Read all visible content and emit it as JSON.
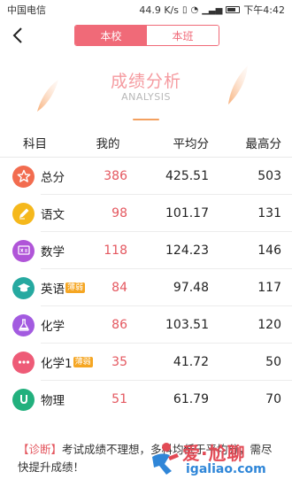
{
  "status_bar": {
    "carrier": "中国电信",
    "speed": "44.9 K/s",
    "time": "下午4:42"
  },
  "nav": {
    "tabs": [
      {
        "label": "本校",
        "active": true
      },
      {
        "label": "本班",
        "active": false
      }
    ]
  },
  "header": {
    "title": "成绩分析",
    "subtitle": "ANALYSIS"
  },
  "table": {
    "columns": [
      "科目",
      "我的",
      "平均分",
      "最高分"
    ],
    "rows": [
      {
        "subject": "总分",
        "icon": "star-icon",
        "icon_color": "#f26c4f",
        "badge": "",
        "mine": "386",
        "avg": "425.51",
        "max": "503"
      },
      {
        "subject": "语文",
        "icon": "pen-icon",
        "icon_color": "#f5b81c",
        "badge": "",
        "mine": "98",
        "avg": "101.17",
        "max": "131"
      },
      {
        "subject": "数学",
        "icon": "math-board-icon",
        "icon_color": "#b055d8",
        "badge": "",
        "mine": "118",
        "avg": "124.23",
        "max": "146"
      },
      {
        "subject": "英语",
        "icon": "graduation-cap-icon",
        "icon_color": "#26a9a0",
        "badge": "薄弱",
        "mine": "84",
        "avg": "97.48",
        "max": "117"
      },
      {
        "subject": "化学",
        "icon": "flask-icon",
        "icon_color": "#a35be0",
        "badge": "",
        "mine": "86",
        "avg": "103.51",
        "max": "120"
      },
      {
        "subject": "化学1",
        "icon": "dots-icon",
        "icon_color": "#ee5b77",
        "badge": "薄弱",
        "mine": "35",
        "avg": "41.72",
        "max": "50"
      },
      {
        "subject": "物理",
        "icon": "magnet-icon",
        "icon_color": "#22b07d",
        "badge": "",
        "mine": "51",
        "avg": "61.79",
        "max": "70"
      }
    ]
  },
  "diagnosis": {
    "tag": "【诊断】",
    "text": "考试成绩不理想，多科均低于平均分，需尽快提升成绩！"
  },
  "watermark": {
    "cn": "爱·尬聊",
    "en": "igaliao.com"
  },
  "colors": {
    "accent": "#f06a78",
    "score_red": "#e4575f",
    "badge_orange": "#f5a623"
  }
}
